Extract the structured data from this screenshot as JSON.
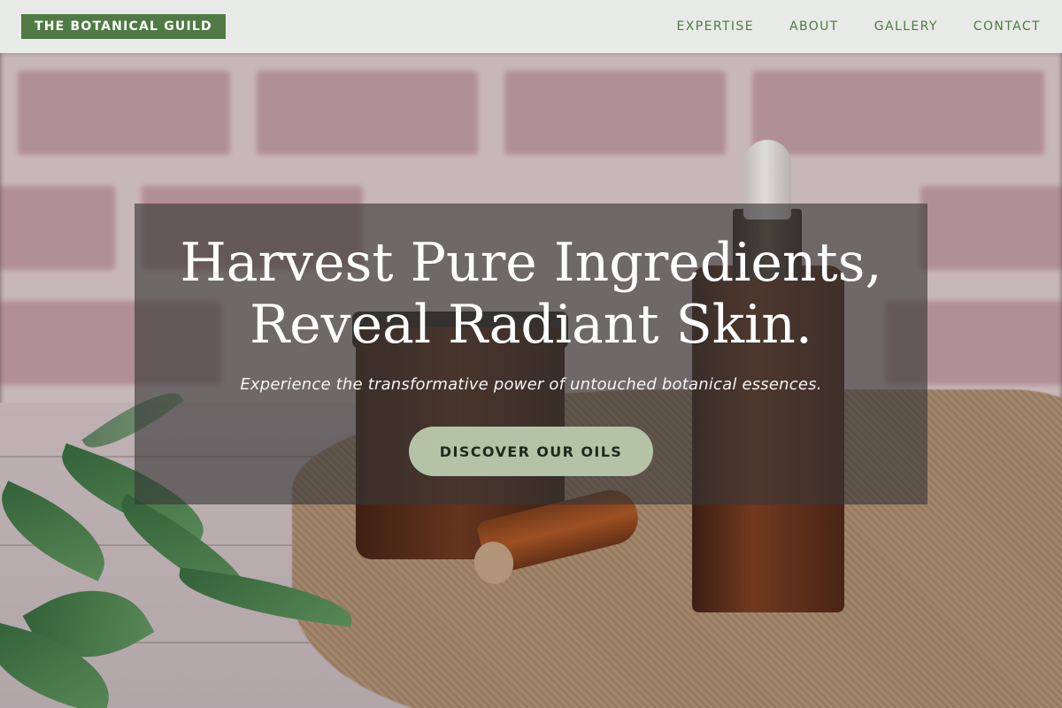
{
  "header": {
    "logo_text": "THE BOTANICAL GUILD",
    "nav": [
      {
        "label": "EXPERTISE"
      },
      {
        "label": "ABOUT"
      },
      {
        "label": "GALLERY"
      },
      {
        "label": "CONTACT"
      }
    ]
  },
  "hero": {
    "title_line_1": "Harvest Pure Ingredients,",
    "title_line_2": "Reveal Radiant Skin.",
    "subtitle": "Experience the transformative power of untouched botanical essences.",
    "cta_label": "DISCOVER OUR OILS",
    "background_image": "essential-oil-bottles-photo"
  },
  "colors": {
    "brand_green": "#4f7a44",
    "header_bg": "#e8eae7",
    "cta_bg": "#b4c3a5",
    "overlay": "rgba(55,55,55,0.62)"
  }
}
